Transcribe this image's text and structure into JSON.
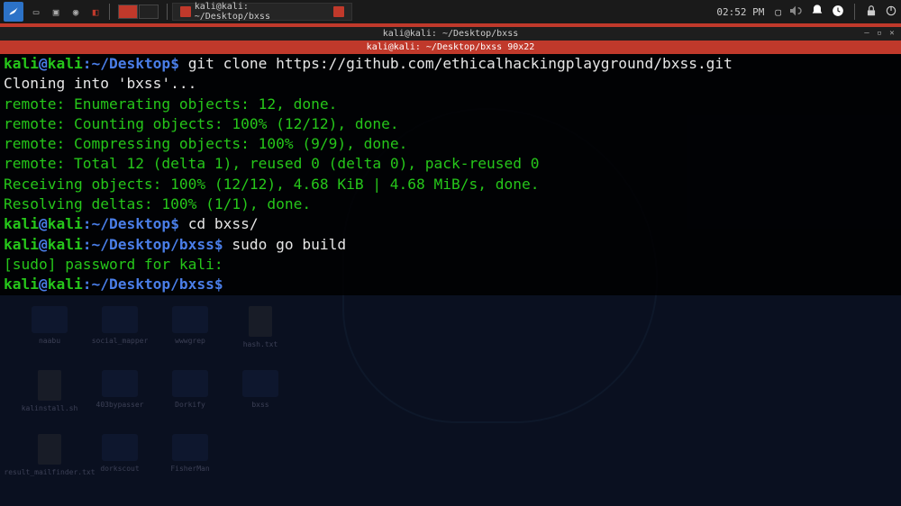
{
  "panel": {
    "taskbar_item": "kali@kali: ~/Desktop/bxss",
    "clock": "02:52 PM"
  },
  "window": {
    "title1": "kali@kali: ~/Desktop/bxss",
    "title2": "kali@kali: ~/Desktop/bxss 90x22"
  },
  "terminal": {
    "lines": [
      {
        "type": "prompt",
        "user": "kali",
        "host": "kali",
        "path": "~/Desktop",
        "cmd": "git clone https://github.com/ethicalhackingplayground/bxss.git"
      },
      {
        "type": "out",
        "text": "Cloning into 'bxss'...",
        "cls": "out-white"
      },
      {
        "type": "remote",
        "label": "remote",
        "text": ": Enumerating objects: 12, done."
      },
      {
        "type": "remote",
        "label": "remote",
        "text": ": Counting objects: 100% (12/12), done."
      },
      {
        "type": "remote",
        "label": "remote",
        "text": ": Compressing objects: 100% (9/9), done."
      },
      {
        "type": "remote",
        "label": "remote",
        "text": ": Total 12 (delta 1), reused 0 (delta 0), pack-reused 0"
      },
      {
        "type": "out",
        "text": "Receiving objects: 100% (12/12), 4.68 KiB | 4.68 MiB/s, done.",
        "cls": "out-green"
      },
      {
        "type": "out",
        "text": "Resolving deltas: 100% (1/1), done.",
        "cls": "out-green"
      },
      {
        "type": "prompt",
        "user": "kali",
        "host": "kali",
        "path": "~/Desktop",
        "cmd": "cd bxss/"
      },
      {
        "type": "prompt",
        "user": "kali",
        "host": "kali",
        "path": "~/Desktop/bxss",
        "cmd": "sudo go build"
      },
      {
        "type": "out",
        "text": "[sudo] password for kali:",
        "cls": "out-green"
      },
      {
        "type": "prompt",
        "user": "kali",
        "host": "kali",
        "path": "~/Desktop/bxss",
        "cmd": ""
      }
    ]
  },
  "desktop_icons": [
    {
      "label": "naabu",
      "type": "folder"
    },
    {
      "label": "social_mapper",
      "type": "folder"
    },
    {
      "label": "wwwgrep",
      "type": "folder"
    },
    {
      "label": "hash.txt",
      "type": "file"
    },
    {
      "label": "kalinstall.sh",
      "type": "file"
    },
    {
      "label": "403bypasser",
      "type": "folder"
    },
    {
      "label": "Dorkify",
      "type": "folder"
    },
    {
      "label": "bxss",
      "type": "folder"
    },
    {
      "label": "result_mailfinder.txt",
      "type": "file"
    },
    {
      "label": "dorkscout",
      "type": "folder"
    },
    {
      "label": "FisherMan",
      "type": "folder"
    }
  ]
}
